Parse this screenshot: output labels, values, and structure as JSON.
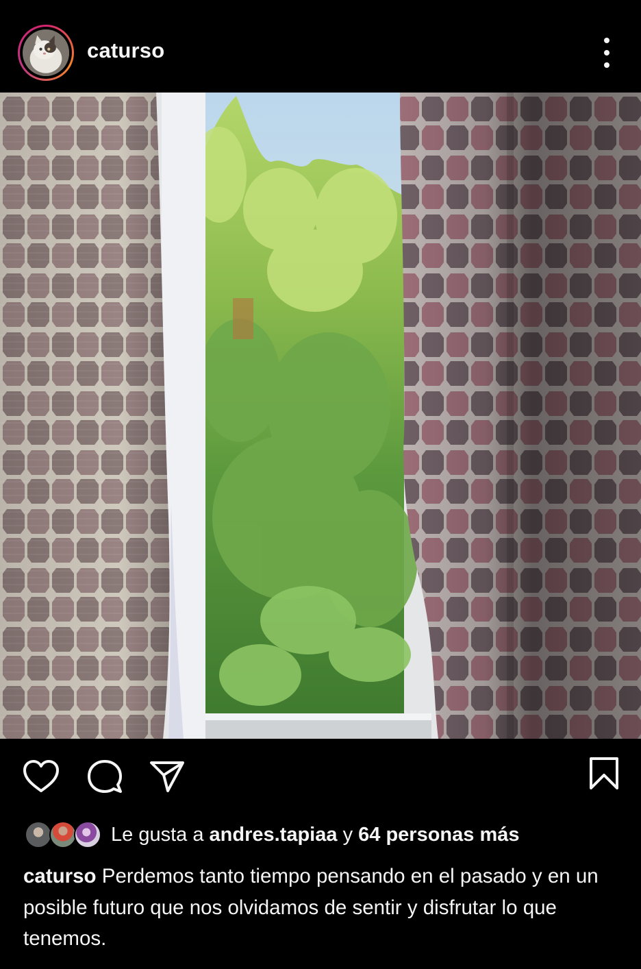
{
  "post": {
    "username": "caturso",
    "avatar_icon": "cat-avatar",
    "more_icon": "more-vertical-icon"
  },
  "actions": {
    "like_icon": "heart-icon",
    "comment_icon": "comment-icon",
    "share_icon": "send-icon",
    "save_icon": "bookmark-icon"
  },
  "likes": {
    "prefix": "Le gusta a",
    "user": "andres.tapiaa",
    "connector": "y",
    "others": "64 personas más"
  },
  "caption": {
    "username": "caturso",
    "text": "Perdemos tanto tiempo pensando en el pasado y en un posible futuro que nos olvidamos de sentir y disfrutar lo que tenemos."
  },
  "colors": {
    "background": "#000000",
    "text": "#f5f5f5",
    "story_ring_start": "#d6246e",
    "story_ring_end": "#f58529"
  }
}
